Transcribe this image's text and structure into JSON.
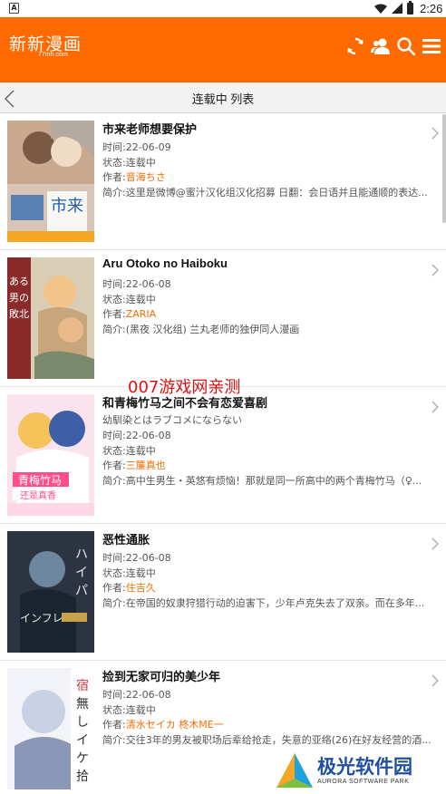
{
  "status_bar": {
    "app_badge": "A",
    "time": "2:26"
  },
  "header": {
    "logo_text": "新新漫画",
    "logo_sub": "77mh.com",
    "icons": [
      "refresh-icon",
      "user-icon",
      "search-icon",
      "menu-icon"
    ],
    "accent": "#ff6a00"
  },
  "subheader": {
    "title": "连载中 列表"
  },
  "labels": {
    "time": "时间:",
    "status": "状态:",
    "author": "作者:",
    "summary": "简介:"
  },
  "items": [
    {
      "title": "市来老师想要保护",
      "alt": "",
      "time": "22-06-09",
      "status": "连载中",
      "author": "音海ちさ",
      "summary": "这里是微博@蜜汁汉化组汉化招募 日翻：会日语并且能通顺的表达..."
    },
    {
      "title": "Aru Otoko no Haiboku",
      "alt": "",
      "time": "22-06-08",
      "status": "连载中",
      "author": "ZARIA",
      "summary": "(黑夜 汉化组) 兰丸老师的独伊同人漫画"
    },
    {
      "title": "和青梅竹马之间不会有恋爱喜剧",
      "alt": "幼馴染とはラブコメにならない",
      "time": "22-06-08",
      "status": "连载中",
      "author": "三簾真也",
      "summary": "高中生男生・英悠有烦恼！那就是同一所高中的两个青梅竹马（♀..."
    },
    {
      "title": "恶性通胀",
      "alt": "",
      "time": "22-06-08",
      "status": "连载中",
      "author": "住吉久",
      "summary": "在帝国的奴隶狩猎行动的迫害下，少年卢克失去了双亲。而在多年..."
    },
    {
      "title": "捡到无家可归的美少年",
      "alt": "",
      "time": "22-06-08",
      "status": "连载中",
      "author": "清水セイカ 柊木ME一",
      "summary": "交往3年的男友被职场后辈给抢走，失意的亚络(26)在好友经营的酒..."
    }
  ],
  "watermark": {
    "text": "007游戏网亲测"
  },
  "brand": {
    "title": "极光软件园",
    "subtitle": "AURORA SOFTWARE PARK"
  }
}
